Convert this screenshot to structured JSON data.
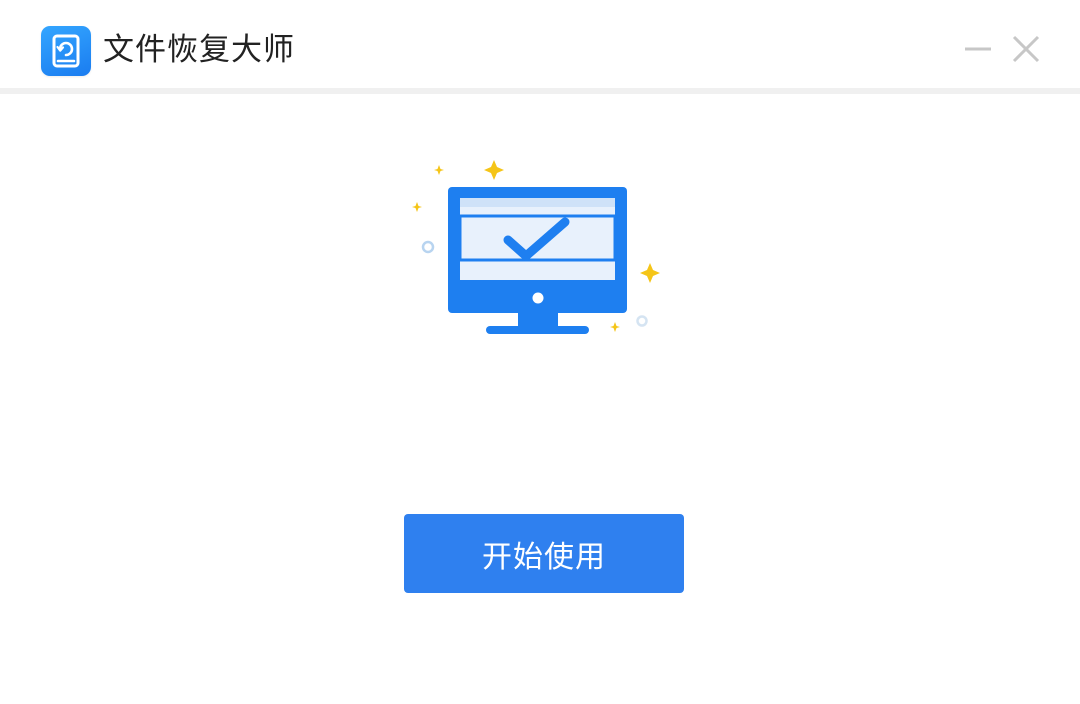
{
  "window": {
    "title": "文件恢复大师",
    "app_icon": "recovery-disk-icon"
  },
  "titlebar_controls": {
    "minimize_icon": "minimize-icon",
    "close_icon": "close-icon"
  },
  "hero": {
    "icon": "monitor-check-icon",
    "accent_color": "#1e7ff0",
    "sparkle_color": "#f5c518"
  },
  "main": {
    "start_button_label": "开始使用",
    "start_button_color": "#2f80ef"
  }
}
